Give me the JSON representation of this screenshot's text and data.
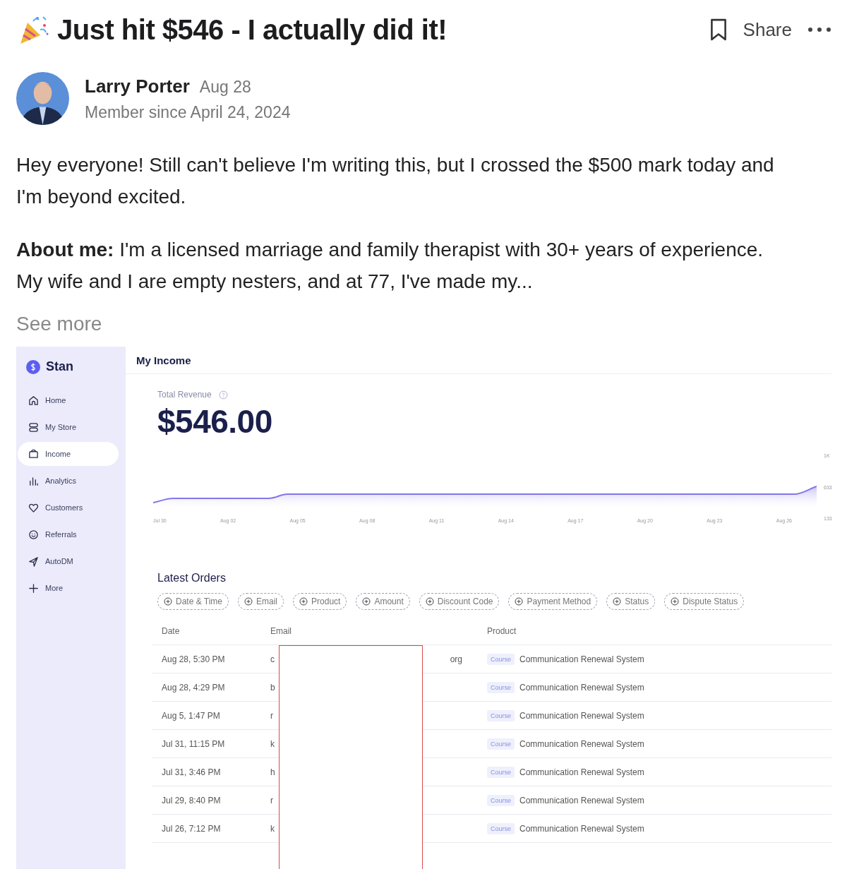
{
  "post": {
    "title": "Just hit $546 - I actually did it!",
    "share": "Share"
  },
  "author": {
    "name": "Larry Porter",
    "date": "Aug 28",
    "member_since": "Member since April 24, 2024"
  },
  "body": [
    "Hey everyone! Still can't believe I'm writing this, but I crossed the $500 mark today and I'm beyond excited.",
    "**About me:** I'm a licensed marriage and family therapist with 30+ years of experience. My wife and I are empty nesters, and at 77, I've made my..."
  ],
  "see_more": "See more",
  "screenshot": {
    "brand": "Stan",
    "nav": [
      {
        "label": "Home",
        "selected": false
      },
      {
        "label": "My Store",
        "selected": false
      },
      {
        "label": "Income",
        "selected": true
      },
      {
        "label": "Analytics",
        "selected": false
      },
      {
        "label": "Customers",
        "selected": false
      },
      {
        "label": "Referrals",
        "selected": false
      },
      {
        "label": "AutoDM",
        "selected": false
      },
      {
        "label": "More",
        "selected": false
      }
    ],
    "header": "My Income",
    "revenue_label": "Total Revenue",
    "revenue": "$546.00",
    "chart_x_labels": [
      "Jul 30",
      "Aug 02",
      "Aug 05",
      "Aug 08",
      "Aug 11",
      "Aug 14",
      "Aug 17",
      "Aug 20",
      "Aug 23",
      "Aug 26"
    ],
    "chart_y_labels": [
      "1K",
      "633",
      "133"
    ],
    "orders_title": "Latest Orders",
    "filters": [
      "Date & Time",
      "Email",
      "Product",
      "Amount",
      "Discount Code",
      "Payment Method",
      "Status",
      "Dispute Status"
    ],
    "columns": [
      "Date",
      "Email",
      "Product"
    ],
    "rows": [
      {
        "date": "Aug 28, 5:30 PM",
        "email": "c",
        "email_tail": "org",
        "tag": "Course",
        "product": "Communication Renewal System"
      },
      {
        "date": "Aug 28, 4:29 PM",
        "email": "b",
        "tag": "Course",
        "product": "Communication Renewal System"
      },
      {
        "date": "Aug 5, 1:47 PM",
        "email": "r",
        "tag": "Course",
        "product": "Communication Renewal System"
      },
      {
        "date": "Jul 31, 11:15 PM",
        "email": "k",
        "tag": "Course",
        "product": "Communication Renewal System"
      },
      {
        "date": "Jul 31, 3:46 PM",
        "email": "h",
        "tag": "Course",
        "product": "Communication Renewal System"
      },
      {
        "date": "Jul 29, 8:40 PM",
        "email": "r",
        "tag": "Course",
        "product": "Communication Renewal System"
      },
      {
        "date": "Jul 26, 7:12 PM",
        "email": "k",
        "tag": "Course",
        "product": "Communication Renewal System"
      }
    ]
  }
}
